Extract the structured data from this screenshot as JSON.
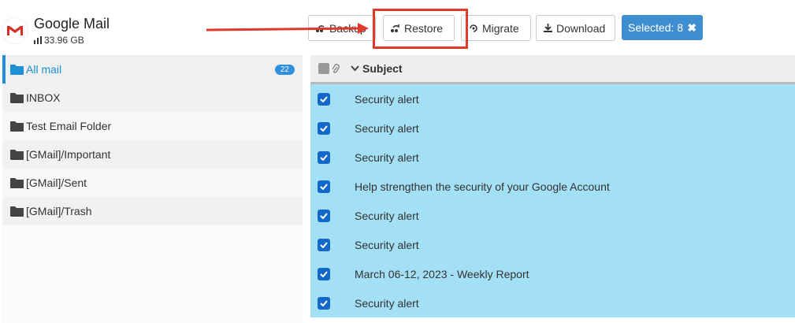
{
  "header": {
    "app_title": "Google Mail",
    "storage": "33.96 GB"
  },
  "toolbar": {
    "backup_label": "Backup",
    "restore_label": "Restore",
    "migrate_label": "Migrate",
    "download_label": "Download",
    "selected_label": "Selected: 8"
  },
  "sidebar": {
    "folders": [
      {
        "label": "All mail",
        "count": "22",
        "active": true
      },
      {
        "label": "INBOX"
      },
      {
        "label": "Test Email Folder"
      },
      {
        "label": "[GMail]/Important"
      },
      {
        "label": "[GMail]/Sent"
      },
      {
        "label": "[GMail]/Trash"
      }
    ]
  },
  "table": {
    "subject_header": "Subject",
    "rows": [
      {
        "subject": "Security alert",
        "checked": true
      },
      {
        "subject": "Security alert",
        "checked": true
      },
      {
        "subject": "Security alert",
        "checked": true
      },
      {
        "subject": "Help strengthen the security of your Google Account",
        "checked": true
      },
      {
        "subject": "Security alert",
        "checked": true
      },
      {
        "subject": "Security alert",
        "checked": true
      },
      {
        "subject": "March 06-12, 2023 - Weekly Report",
        "checked": true
      },
      {
        "subject": "Security alert",
        "checked": true
      }
    ]
  },
  "colors": {
    "accent": "#3f8fd0",
    "row_selected": "#a3dff5",
    "annotation": "#e03a2a"
  }
}
